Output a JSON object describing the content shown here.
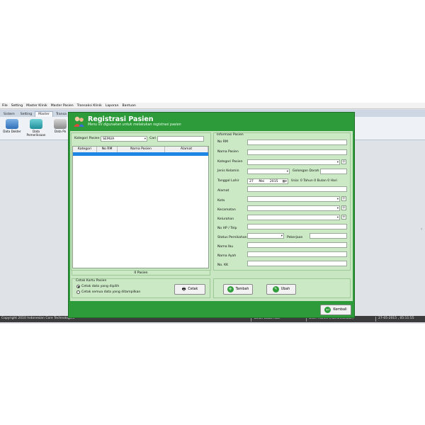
{
  "menu": [
    "File",
    "Setting",
    "Master Klinik",
    "Master Pasien",
    "Transaksi Klinik",
    "Laporan",
    "Bantuan"
  ],
  "ribbon_tabs": [
    "Sistem",
    "Setting",
    "Master",
    "Transa"
  ],
  "ribbon_buttons": [
    {
      "label": "Data Dokter",
      "icon": "doctor-icon"
    },
    {
      "label": "Data Pemeriksaan",
      "icon": "stethoscope-icon"
    },
    {
      "label": "Data Po",
      "icon": "clinic-icon"
    }
  ],
  "status": {
    "copyright": "Copyright 2010 Indonesian Core Technologies",
    "fiscal_year": "Tahun Buku Aktif",
    "user": "User: Admin (Administrator)",
    "datetime": "27-05-2015 , 05:11:55"
  },
  "dialog": {
    "title": "Registrasi Pasien",
    "subtitle": "Menu ini digunakan untuk melakukan registrasi pasien",
    "filter": {
      "kategori_label": "Kategori Pasien",
      "kategori_value": "SEMUA",
      "cari_label": "Cari",
      "cari_value": ""
    },
    "table": {
      "columns": [
        "Kategori",
        "No RM",
        "Nama Pasien",
        "Alamat"
      ],
      "rows": []
    },
    "count": "0 Pasien",
    "print": {
      "legend": "Cetak Kartu Pasien",
      "options": [
        "Cetak data yang dipilih",
        "Cetak semua data yang ditampilkan"
      ],
      "selected": 0,
      "button": "Cetak"
    },
    "info": {
      "legend": "Informasi Pasien",
      "no_rm": "No RM",
      "nama_pasien": "Nama Pasien",
      "kategori_pasien": "Kategori Pasien",
      "jenis_kelamin": "Jenis Kelamin",
      "golongan_darah": "Golongan Darah",
      "tanggal_lahir": "Tanggal Lahir",
      "tgl_day": "27",
      "tgl_month": "Mei",
      "tgl_year": "2015",
      "usia": "Usia: 0 Tahun 0 Bulan 0 Hari",
      "alamat": "Alamat",
      "kota": "Kota",
      "kecamatan": "Kecamatan",
      "kelurahan": "Kelurahan",
      "no_hp": "No HP / Telp",
      "status_pernikahan": "Status Pernikahan",
      "pekerjaan": "Pekerjaan",
      "nama_ibu": "Nama Ibu",
      "nama_ayah": "Nama Ayah",
      "no_kk": "No. KK"
    },
    "buttons": {
      "tambah": "Tambah",
      "ubah": "Ubah",
      "kembali": "Kembali"
    }
  },
  "colors": {
    "dialog_green": "#2e9b3b",
    "panel_green": "#cbe9c5",
    "selection_blue": "#1e86e3"
  }
}
